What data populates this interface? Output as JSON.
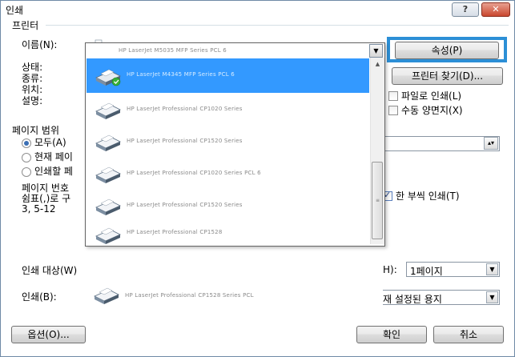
{
  "window": {
    "title": "인쇄",
    "help_label": "?",
    "close_label": "✕"
  },
  "printer_group": {
    "title": "프린터",
    "name_label": "이름(N):",
    "status_label": "상태:",
    "type_label": "종류:",
    "location_label": "위치:",
    "comment_label": "설명:",
    "selected_printer": "HP LaserJet M5035 MFP Series PCL 6",
    "properties_button": "속성(P)",
    "find_printer_button": "프린터 찾기(D)...",
    "print_to_file": {
      "label": "파일로 인쇄(L)",
      "checked": false
    },
    "manual_duplex": {
      "label": "수동 양면지(X)",
      "checked": false
    }
  },
  "printer_list": {
    "items": [
      {
        "name": "HP LaserJet M4345 MFP Series PCL 6",
        "selected": true,
        "icon": "printer-default-icon"
      },
      {
        "name": "HP LaserJet Professional CP1020 Series",
        "selected": false,
        "icon": "printer-icon"
      },
      {
        "name": "HP LaserJet Professional CP1520 Series",
        "selected": false,
        "icon": "printer-icon"
      },
      {
        "name": "HP LaserJet Professional CP1020 Series PCL 6",
        "selected": false,
        "icon": "printer-icon"
      },
      {
        "name": "HP LaserJet Professional CP1520 Series",
        "selected": false,
        "icon": "printer-icon"
      },
      {
        "name": "HP LaserJet Professional CP1528",
        "selected": false,
        "icon": "printer-icon"
      },
      {
        "name": "HP LaserJet Professional CP1528 Series PCL",
        "selected": false,
        "icon": "printer-icon"
      }
    ]
  },
  "page_range": {
    "title": "페이지 범위",
    "all_label": "모두(A)",
    "current_label": "현재 페이",
    "selection_label": "인쇄할 페",
    "selected_option": "all",
    "help_line1": "페이지 번호",
    "help_line2": "쉼표(,)로 구",
    "help_line3": "3, 5-12"
  },
  "copies": {
    "collate_label": "한 부씩 인쇄(T)",
    "collate_checked": true
  },
  "print_what": {
    "label": "인쇄 대상(W)"
  },
  "print_range": {
    "label": "인쇄(B):"
  },
  "zoom": {
    "pages_label": "H):",
    "pages_value": "1페이지",
    "scale_value": "재 설정된 용지"
  },
  "footer": {
    "options_button": "옵션(O)...",
    "ok_button": "확인",
    "cancel_button": "취소"
  }
}
